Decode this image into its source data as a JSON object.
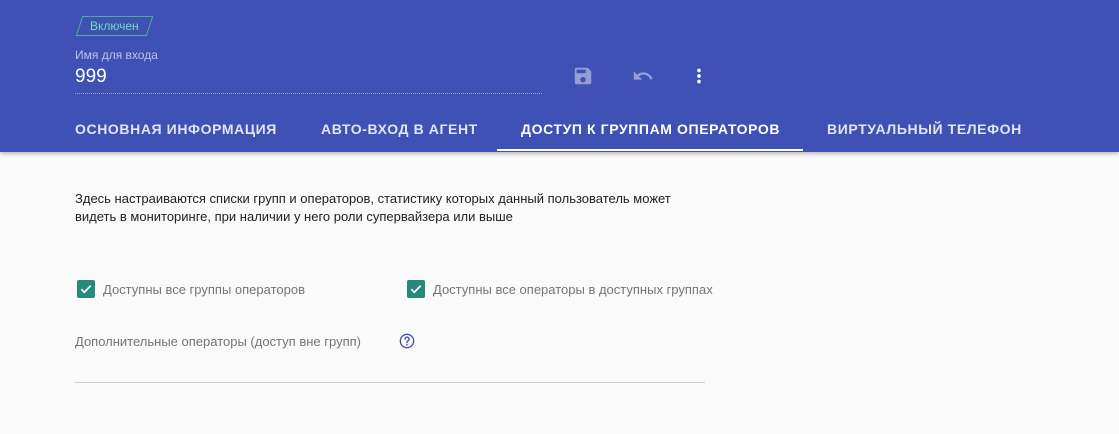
{
  "header": {
    "status_badge": "Включен",
    "login_label": "Имя для входа",
    "login_value": "999",
    "toolbar": {
      "save_icon": "save-icon",
      "undo_icon": "undo-icon",
      "more_icon": "more-vert-icon"
    }
  },
  "tabs": [
    {
      "label": "ОСНОВНАЯ ИНФОРМАЦИЯ",
      "active": false
    },
    {
      "label": "АВТО-ВХОД В АГЕНТ",
      "active": false
    },
    {
      "label": "ДОСТУП К ГРУППАМ ОПЕРАТОРОВ",
      "active": true
    },
    {
      "label": "ВИРТУАЛЬНЫЙ ТЕЛЕФОН",
      "active": false
    }
  ],
  "content": {
    "description": "Здесь настраиваются списки групп и операторов, статистику которых данный пользователь может видеть в мониторинге, при наличии у него роли супервайзера или выше",
    "checkboxes": [
      {
        "label": "Доступны все группы операторов",
        "checked": true
      },
      {
        "label": "Доступны все операторы в доступных группах",
        "checked": true
      }
    ],
    "extra_operators_label": "Дополнительные операторы (доступ вне групп)"
  },
  "colors": {
    "header_bg": "#3f51b5",
    "checkbox_accent": "#26897a",
    "badge_green": "#6fe0b0"
  }
}
